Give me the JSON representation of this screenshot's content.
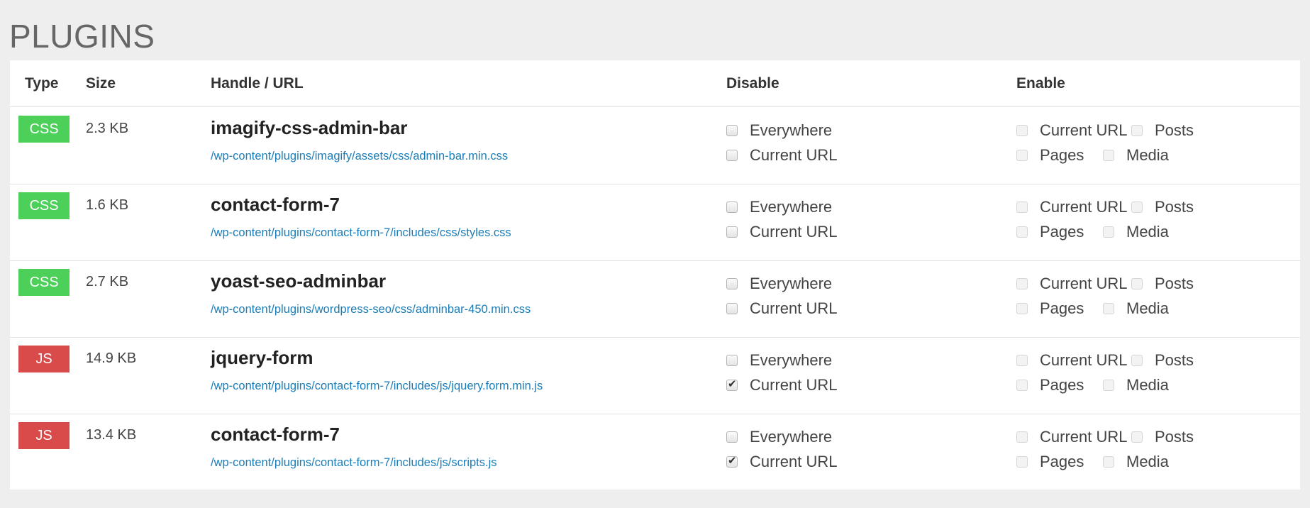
{
  "page_title": "PLUGINS",
  "columns": {
    "type": "Type",
    "size": "Size",
    "handle": "Handle / URL",
    "disable": "Disable",
    "enable": "Enable"
  },
  "colors": {
    "css": "#4cd05a",
    "js": "#d94a4a",
    "link": "#1a7db8"
  },
  "rows": [
    {
      "type": "CSS",
      "size": "2.3 KB",
      "handle": "imagify-css-admin-bar",
      "url": "/wp-content/plugins/imagify/assets/css/admin-bar.min.css",
      "disable": [
        {
          "label": "Everywhere",
          "checked": false
        },
        {
          "label": "Current URL",
          "checked": false
        }
      ],
      "enable": [
        {
          "label": "Current URL",
          "checked": false
        },
        {
          "label": "Posts",
          "checked": false
        },
        {
          "label": "Pages",
          "checked": false
        },
        {
          "label": "Media",
          "checked": false
        }
      ]
    },
    {
      "type": "CSS",
      "size": "1.6 KB",
      "handle": "contact-form-7",
      "url": "/wp-content/plugins/contact-form-7/includes/css/styles.css",
      "disable": [
        {
          "label": "Everywhere",
          "checked": false
        },
        {
          "label": "Current URL",
          "checked": false
        }
      ],
      "enable": [
        {
          "label": "Current URL",
          "checked": false
        },
        {
          "label": "Posts",
          "checked": false
        },
        {
          "label": "Pages",
          "checked": false
        },
        {
          "label": "Media",
          "checked": false
        }
      ]
    },
    {
      "type": "CSS",
      "size": "2.7 KB",
      "handle": "yoast-seo-adminbar",
      "url": "/wp-content/plugins/wordpress-seo/css/adminbar-450.min.css",
      "disable": [
        {
          "label": "Everywhere",
          "checked": false
        },
        {
          "label": "Current URL",
          "checked": false
        }
      ],
      "enable": [
        {
          "label": "Current URL",
          "checked": false
        },
        {
          "label": "Posts",
          "checked": false
        },
        {
          "label": "Pages",
          "checked": false
        },
        {
          "label": "Media",
          "checked": false
        }
      ]
    },
    {
      "type": "JS",
      "size": "14.9 KB",
      "handle": "jquery-form",
      "url": "/wp-content/plugins/contact-form-7/includes/js/jquery.form.min.js",
      "disable": [
        {
          "label": "Everywhere",
          "checked": false
        },
        {
          "label": "Current URL",
          "checked": true
        }
      ],
      "enable": [
        {
          "label": "Current URL",
          "checked": false
        },
        {
          "label": "Posts",
          "checked": false
        },
        {
          "label": "Pages",
          "checked": false
        },
        {
          "label": "Media",
          "checked": false
        }
      ]
    },
    {
      "type": "JS",
      "size": "13.4 KB",
      "handle": "contact-form-7",
      "url": "/wp-content/plugins/contact-form-7/includes/js/scripts.js",
      "disable": [
        {
          "label": "Everywhere",
          "checked": false
        },
        {
          "label": "Current URL",
          "checked": true
        }
      ],
      "enable": [
        {
          "label": "Current URL",
          "checked": false
        },
        {
          "label": "Posts",
          "checked": false
        },
        {
          "label": "Pages",
          "checked": false
        },
        {
          "label": "Media",
          "checked": false
        }
      ]
    }
  ]
}
